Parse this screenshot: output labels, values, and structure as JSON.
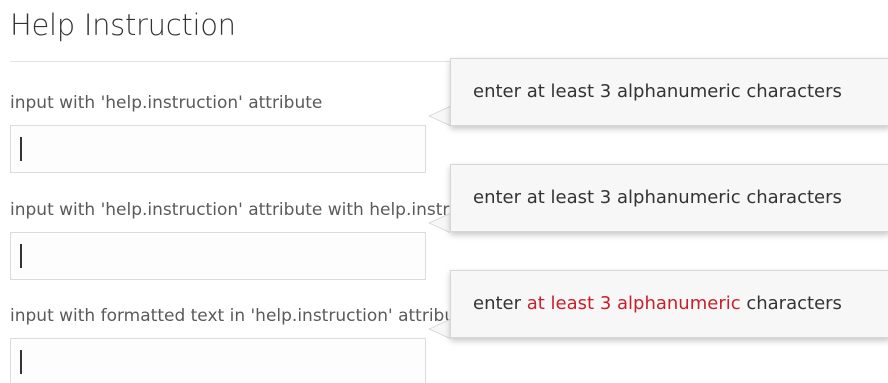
{
  "page": {
    "title": "Help Instruction"
  },
  "fields": [
    {
      "label": "input with 'help.instruction' attribute",
      "value": "",
      "tooltip": "enter at least 3 alphanumeric characters"
    },
    {
      "label": "input with 'help.instruction' attribute with help.instruction",
      "value": "",
      "tooltip": "enter at least 3 alphanumeric characters"
    },
    {
      "label": "input with formatted text in 'help.instruction' attribute",
      "value": "",
      "tooltip_parts": {
        "before": "enter ",
        "highlight": "at least 3 alphanumeric",
        "after": " characters"
      }
    }
  ],
  "colors": {
    "highlight": "#c8202a",
    "text": "#333333",
    "label": "#5a5a5a"
  }
}
